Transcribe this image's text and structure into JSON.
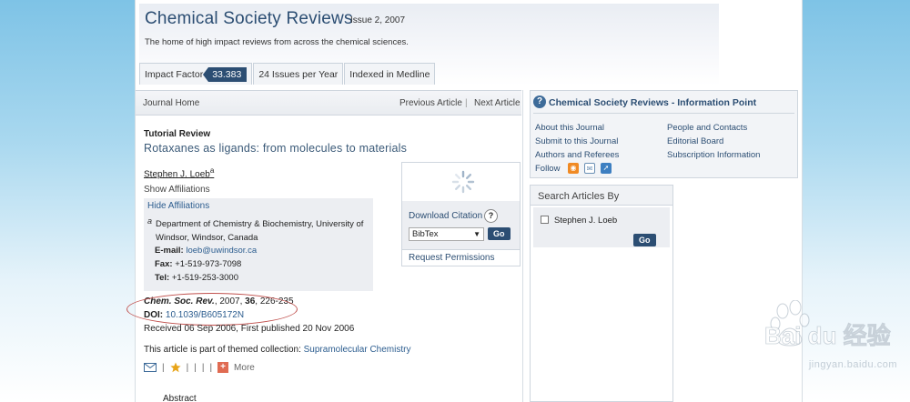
{
  "header": {
    "title": "Chemical Society Reviews",
    "issue": "Issue 2, 2007",
    "tagline": "The home of high impact reviews from across the chemical sciences.",
    "tabs": [
      {
        "label": "Impact Factor",
        "badge": "33.383"
      },
      {
        "label": "24 Issues per Year"
      },
      {
        "label": "Indexed in Medline"
      }
    ]
  },
  "article_nav": {
    "home": "Journal Home",
    "prev": "Previous Article",
    "separator": "|",
    "next": "Next Article"
  },
  "article": {
    "type": "Tutorial Review",
    "title": "Rotaxanes as ligands: from molecules to materials",
    "author": "Stephen J. Loeb",
    "author_sup": "a",
    "show_affiliations": "Show Affiliations",
    "hide_affiliations": "Hide Affiliations",
    "affiliation_marker": "a",
    "affiliation": "Department of Chemistry & Biochemistry, University of Windsor, Windsor, Canada",
    "email_label": "E-mail:",
    "email": "loeb@uwindsor.ca",
    "fax_label": "Fax:",
    "fax": "+1-519-973-7098",
    "tel_label": "Tel:",
    "tel": "+1-519-253-3000",
    "citation_journal": "Chem. Soc. Rev.",
    "citation_year": ", 2007, ",
    "citation_volume": "36",
    "citation_pages": ", 226-235",
    "doi_label": "DOI:",
    "doi": "10.1039/B605172N",
    "received": "Received 06 Sep 2006, First published 20 Nov 2006",
    "themed_prefix": "This article is part of themed collection: ",
    "themed_link": "Supramolecular Chemistry",
    "more": "More",
    "abstract": "Abstract"
  },
  "download": {
    "title": "Download Citation",
    "help": "?",
    "format": "BibTex",
    "go": "Go",
    "permissions": "Request Permissions"
  },
  "info_point": {
    "title": "Chemical Society Reviews - Information Point",
    "left": [
      "About this Journal",
      "Submit to this Journal",
      "Authors and Referees",
      "Follow"
    ],
    "right": [
      "People and Contacts",
      "Editorial Board",
      "Subscription Information"
    ]
  },
  "search": {
    "title": "Search Articles By",
    "option": "Stephen J. Loeb",
    "go": "Go"
  },
  "watermark": {
    "text": "jingyan.baidu.com",
    "logo_text": "Bai du 经验"
  },
  "colors": {
    "accent": "#2c4e73",
    "link": "#2c5d8f",
    "highlight_ellipse": "#c0504d"
  }
}
